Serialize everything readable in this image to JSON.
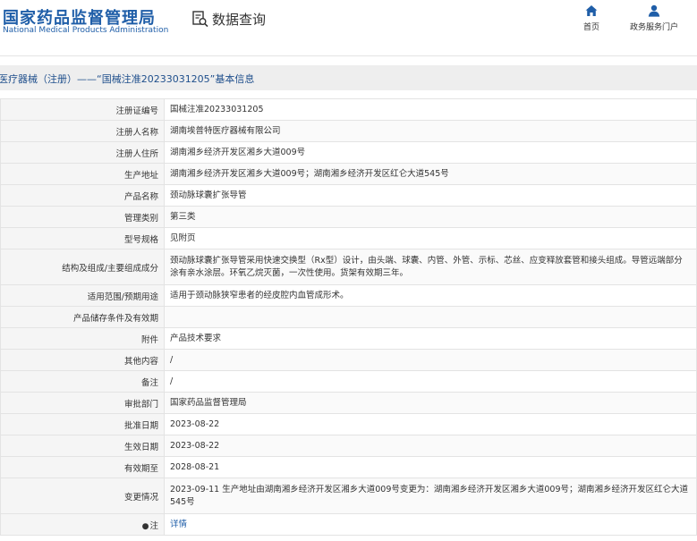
{
  "header": {
    "logo_cn": "国家药品监督管理局",
    "logo_en": "National Medical Products Administration",
    "query_label": "数据查询",
    "nav": {
      "home_label": "首页",
      "service_label": "政务服务门户"
    },
    "accent_color": "#1f5ea8"
  },
  "title_bar": {
    "text": "医疗器械（注册）——“国械注准20233031205”基本信息"
  },
  "table": {
    "rows": [
      {
        "label": "注册证编号",
        "value": "国械注准20233031205"
      },
      {
        "label": "注册人名称",
        "value": "湖南埃普特医疗器械有限公司"
      },
      {
        "label": "注册人住所",
        "value": "湖南湘乡经济开发区湘乡大道009号"
      },
      {
        "label": "生产地址",
        "value": "湖南湘乡经济开发区湘乡大道009号；湖南湘乡经济开发区红仑大道545号"
      },
      {
        "label": "产品名称",
        "value": "颈动脉球囊扩张导管"
      },
      {
        "label": "管理类别",
        "value": "第三类"
      },
      {
        "label": "型号规格",
        "value": "见附页"
      },
      {
        "label": "结构及组成/主要组成成分",
        "value": "颈动脉球囊扩张导管采用快速交换型（Rx型）设计，由头端、球囊、内管、外管、示标、芯丝、应变释放套管和接头组成。导管远端部分涂有亲水涂层。环氧乙烷灭菌，一次性使用。货架有效期三年。"
      },
      {
        "label": "适用范围/预期用途",
        "value": "适用于颈动脉狭窄患者的经皮腔内血管成形术。"
      },
      {
        "label": "产品储存条件及有效期",
        "value": ""
      },
      {
        "label": "附件",
        "value": "产品技术要求"
      },
      {
        "label": "其他内容",
        "value": "/"
      },
      {
        "label": "备注",
        "value": "/"
      },
      {
        "label": "审批部门",
        "value": "国家药品监督管理局"
      },
      {
        "label": "批准日期",
        "value": "2023-08-22"
      },
      {
        "label": "生效日期",
        "value": "2023-08-22"
      },
      {
        "label": "有效期至",
        "value": "2028-08-21"
      },
      {
        "label": "变更情况",
        "value": "2023-09-11 生产地址由湖南湘乡经济开发区湘乡大道009号变更为：湖南湘乡经济开发区湘乡大道009号；湖南湘乡经济开发区红仑大道545号"
      }
    ],
    "note_label": "注",
    "note_link": "详情"
  }
}
